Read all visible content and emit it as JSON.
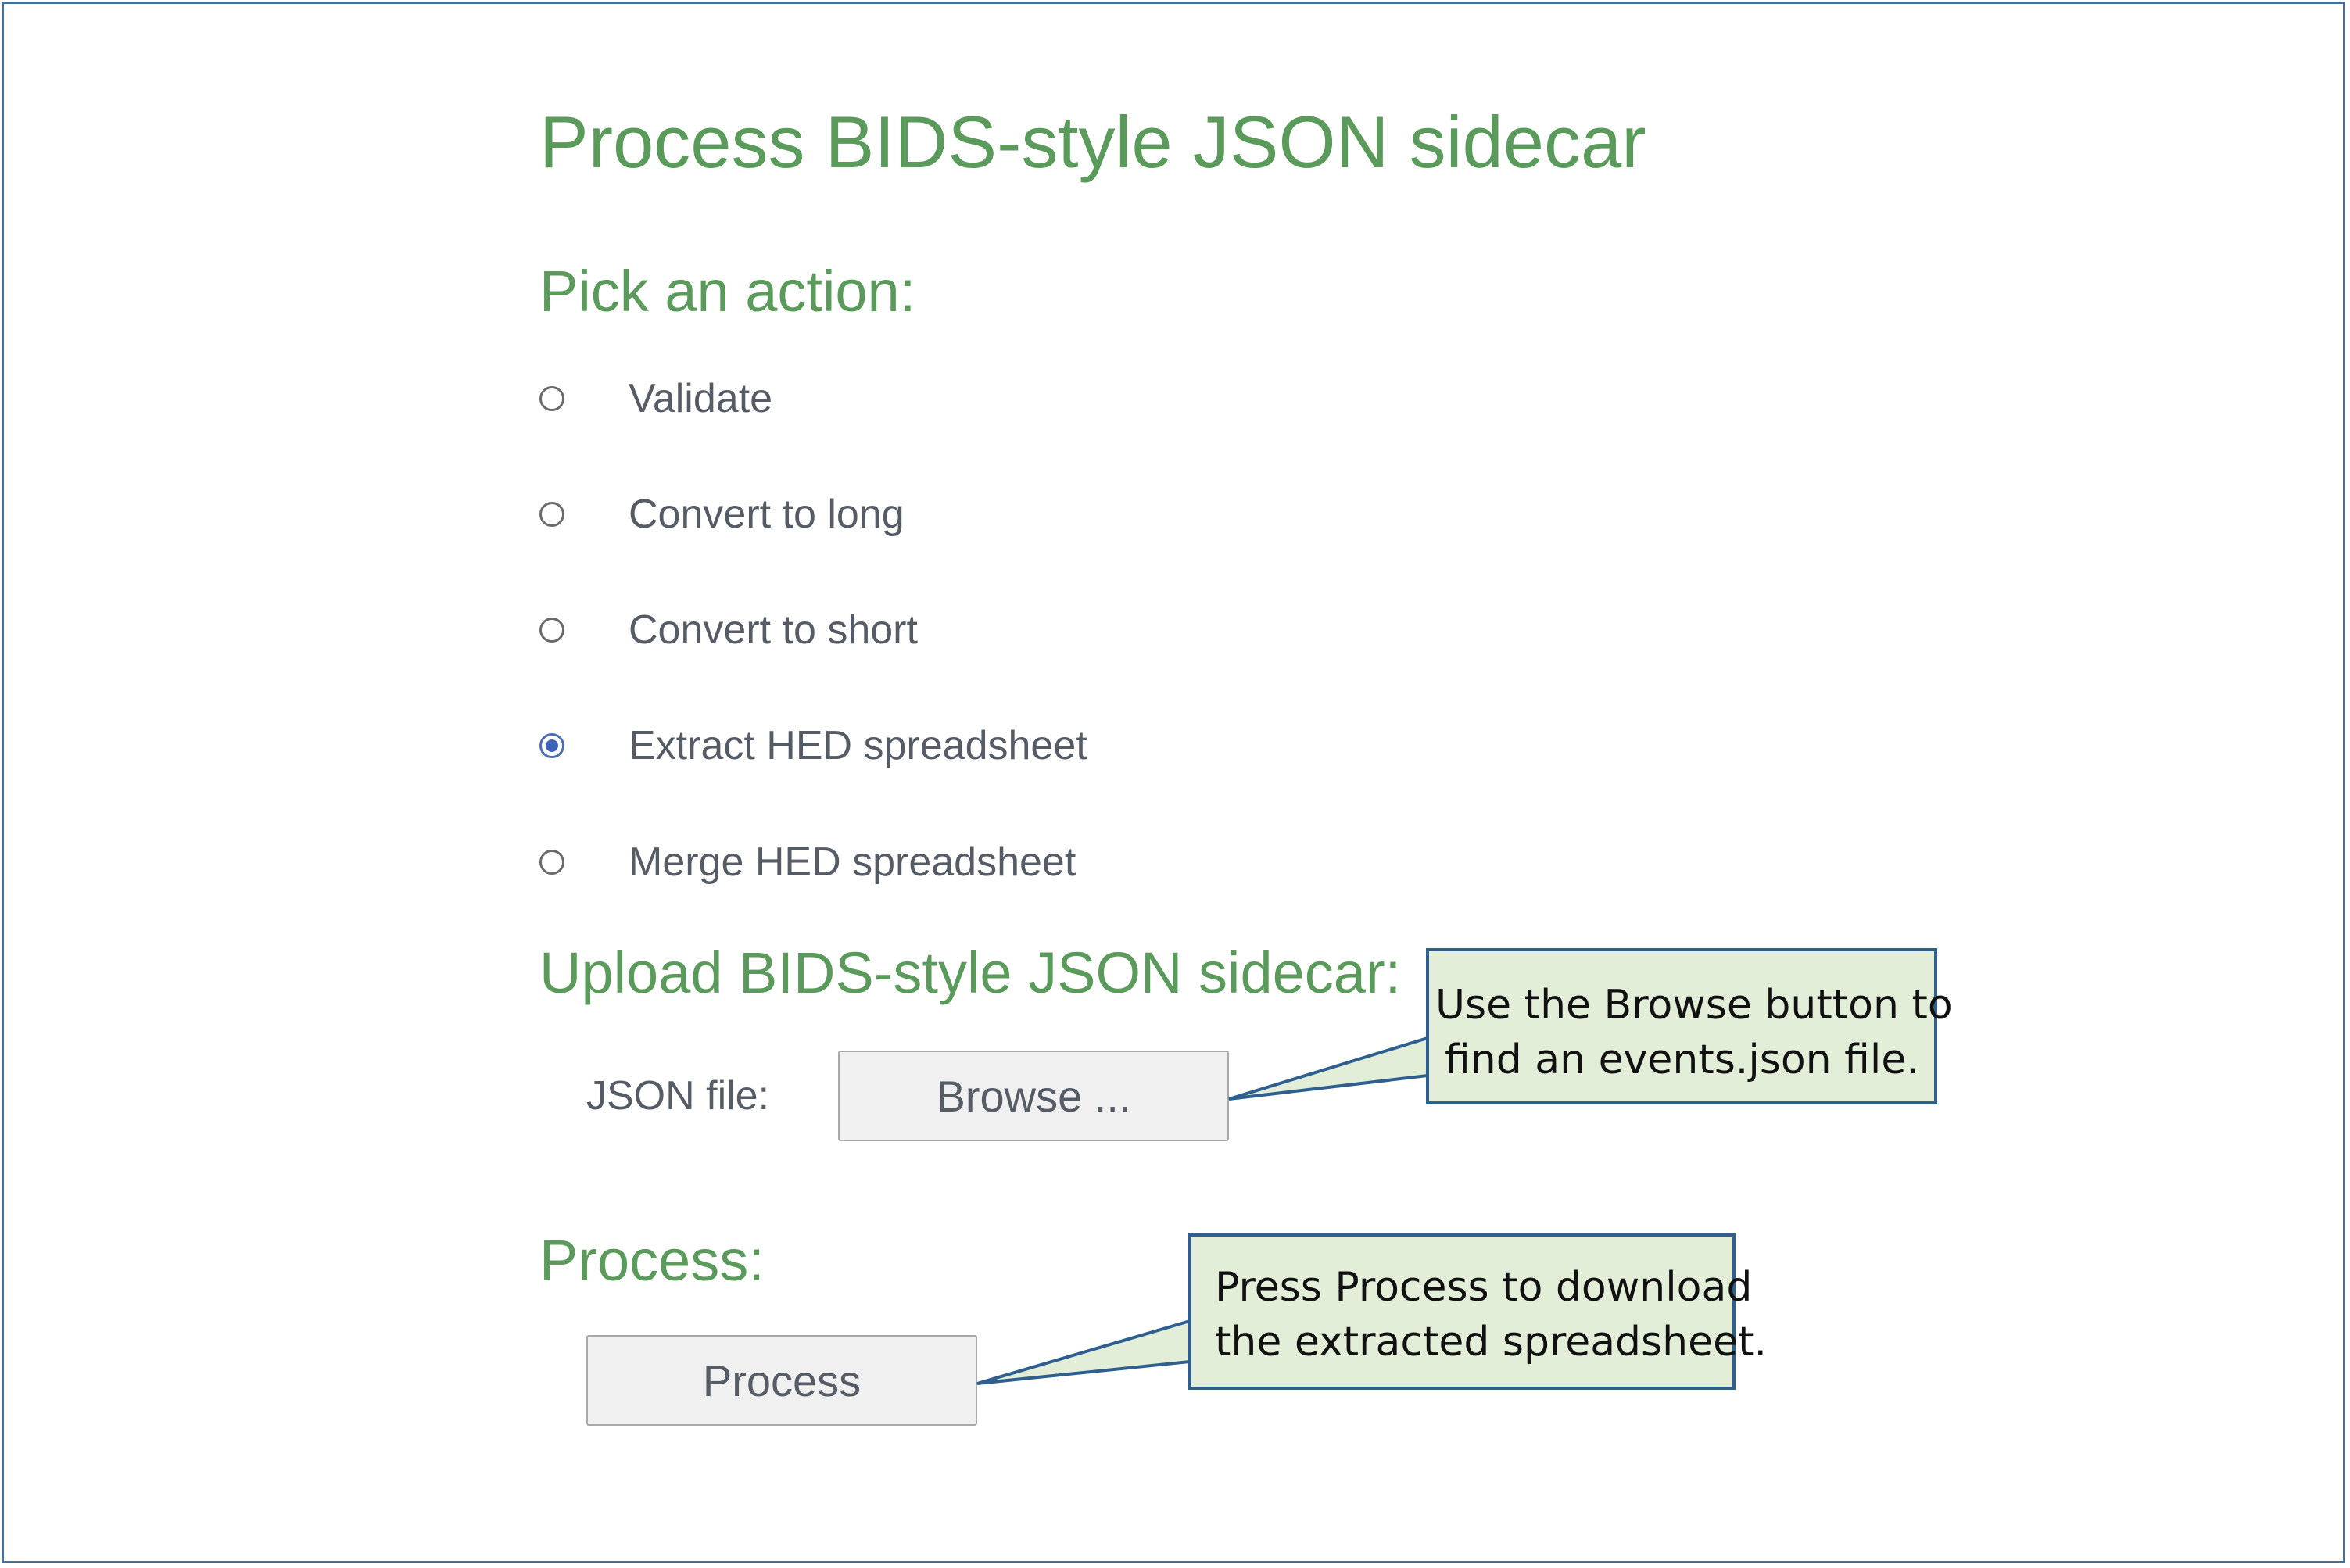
{
  "page": {
    "title": "Process BIDS-style JSON sidecar"
  },
  "actions": {
    "heading": "Pick an action:",
    "options": [
      {
        "label": "Validate",
        "checked": false
      },
      {
        "label": "Convert to long",
        "checked": false
      },
      {
        "label": "Convert to short",
        "checked": false
      },
      {
        "label": "Extract HED spreadsheet",
        "checked": true
      },
      {
        "label": "Merge HED spreadsheet",
        "checked": false
      }
    ],
    "selected": "Extract HED spreadsheet"
  },
  "upload": {
    "heading": "Upload BIDS-style JSON sidecar:",
    "field_label": "JSON file:",
    "browse_label": "Browse ..."
  },
  "process": {
    "heading": "Process:",
    "button_label": "Process"
  },
  "callouts": {
    "browse": {
      "line1": "Use the Browse button to",
      "line2": "find an events.json file."
    },
    "process": {
      "line1": "Press Process to download",
      "line2": "the extracted spreadsheet."
    }
  },
  "colors": {
    "heading": "#5a9a5a",
    "text": "#555c66",
    "radio_selected": "#3b63b8",
    "callout_fill": "#e2eed8",
    "callout_border": "#2e5f8f",
    "frame_border": "#4a6f96"
  }
}
